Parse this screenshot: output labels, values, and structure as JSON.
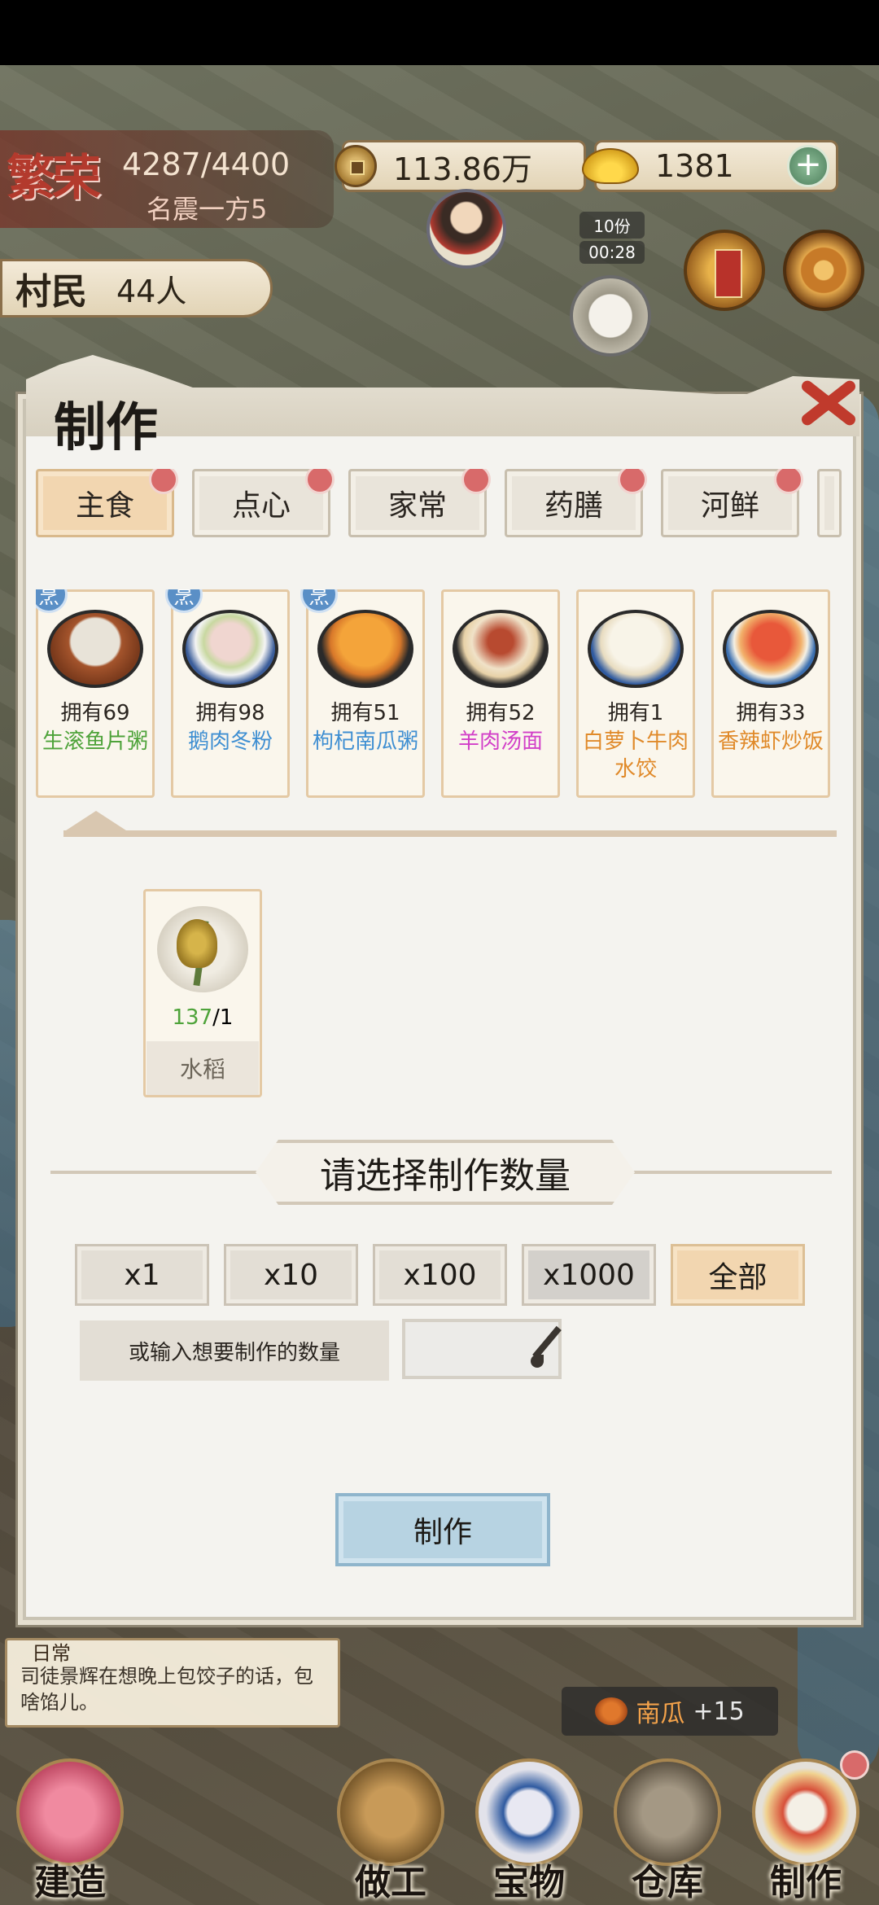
{
  "hud": {
    "prosperity_title": "繁荣",
    "prosperity_value": "4287/4400",
    "prosperity_rank": "名震一方5",
    "coins": "113.86万",
    "gold": "1381",
    "villager_label": "村民",
    "villager_count": "44人",
    "timer_portion": "10份",
    "timer_time": "00:28"
  },
  "modal": {
    "title": "制作",
    "tabs": [
      {
        "label": "主食",
        "active": true
      },
      {
        "label": "点心",
        "active": false
      },
      {
        "label": "家常",
        "active": false
      },
      {
        "label": "药膳",
        "active": false
      },
      {
        "label": "河鲜",
        "active": false
      }
    ],
    "cook_badge": "烹",
    "dishes": [
      {
        "owned": "拥有69",
        "name": "生滚鱼片粥",
        "name_color": "#4ea33a",
        "cook": true
      },
      {
        "owned": "拥有98",
        "name": "鹅肉冬粉",
        "name_color": "#3f8fd2",
        "cook": true
      },
      {
        "owned": "拥有51",
        "name": "枸杞南瓜粥",
        "name_color": "#3f8fd2",
        "cook": true
      },
      {
        "owned": "拥有52",
        "name": "羊肉汤面",
        "name_color": "#d23fc8",
        "cook": false
      },
      {
        "owned": "拥有1",
        "name": "白萝卜牛肉水饺",
        "name_color": "#e08a2a",
        "cook": false
      },
      {
        "owned": "拥有33",
        "name": "香辣虾炒饭",
        "name_color": "#e08a2a",
        "cook": false
      }
    ],
    "ingredient": {
      "have": "137",
      "need": "/1",
      "name": "水稻"
    },
    "section_title": "请选择制作数量",
    "quantity_options": [
      "x1",
      "x10",
      "x100",
      "x1000",
      "全部"
    ],
    "input_hint": "或输入想要制作的数量",
    "input_value": "",
    "make_button": "制作"
  },
  "daily": {
    "tag": "日常",
    "text": "司徒景辉在想晚上包饺子的话，包啥馅儿。"
  },
  "harvest": {
    "item": "南瓜",
    "amount": "+15"
  },
  "nav": {
    "build": "建造",
    "work": "做工",
    "treasure": "宝物",
    "storage": "仓库",
    "craft": "制作"
  }
}
